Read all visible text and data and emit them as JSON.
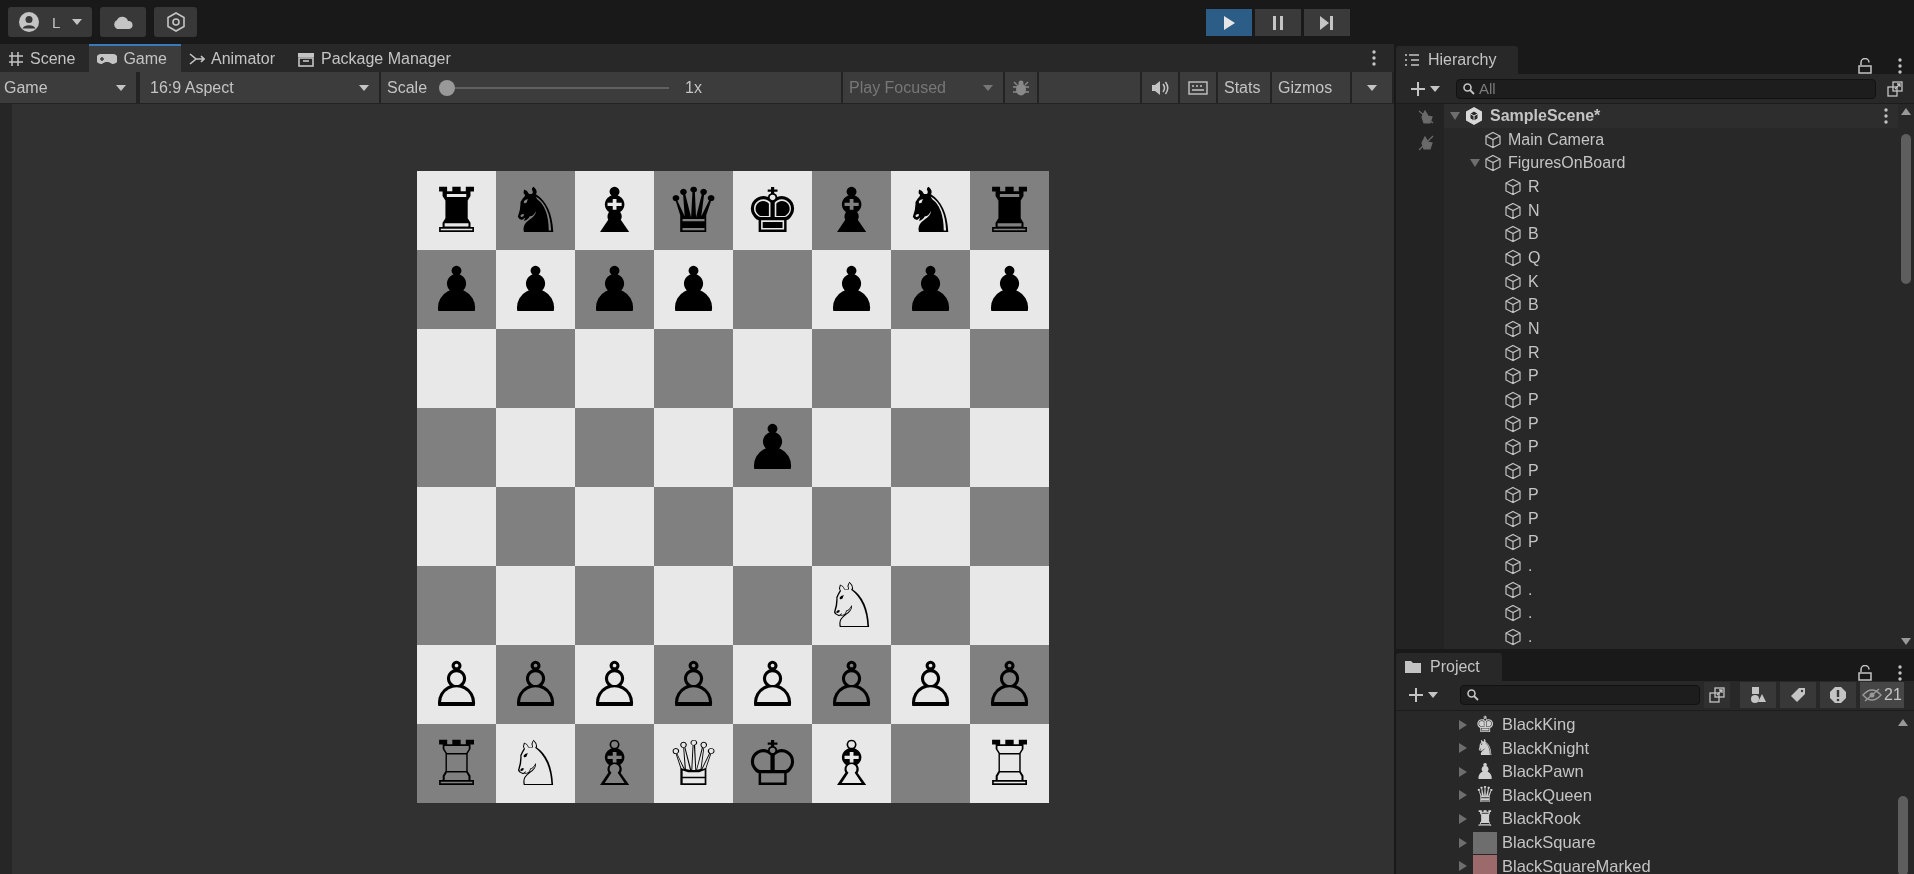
{
  "toolbar": {
    "account": {
      "label": "L"
    },
    "play_buttons": [
      {
        "kind": "play",
        "on": true
      },
      {
        "kind": "pause",
        "on": false
      },
      {
        "kind": "step",
        "on": false
      }
    ]
  },
  "editor_tabs": [
    {
      "label": "Scene",
      "kind": "scene",
      "selected": false
    },
    {
      "label": "Game",
      "kind": "game",
      "selected": true
    },
    {
      "label": "Animator",
      "kind": "animator",
      "selected": false
    },
    {
      "label": "Package Manager",
      "kind": "package",
      "selected": false
    }
  ],
  "game_toolbar": {
    "display": "Game",
    "aspect": "16:9 Aspect",
    "scale": {
      "label": "Scale",
      "level": 0,
      "reading": "1x"
    },
    "play_mode": "Play Focused",
    "stats": "Stats",
    "gizmos": "Gizmos"
  },
  "board": {
    "ranks": [
      [
        {
          "color": "#e8e8e8",
          "piece": "♜"
        },
        {
          "color": "#808080",
          "piece": "♞"
        },
        {
          "color": "#e8e8e8",
          "piece": "♝"
        },
        {
          "color": "#808080",
          "piece": "♛"
        },
        {
          "color": "#e8e8e8",
          "piece": "♚"
        },
        {
          "color": "#808080",
          "piece": "♝"
        },
        {
          "color": "#e8e8e8",
          "piece": "♞"
        },
        {
          "color": "#808080",
          "piece": "♜"
        }
      ],
      [
        {
          "color": "#808080",
          "piece": "♟"
        },
        {
          "color": "#e8e8e8",
          "piece": "♟"
        },
        {
          "color": "#808080",
          "piece": "♟"
        },
        {
          "color": "#e8e8e8",
          "piece": "♟"
        },
        {
          "color": "#808080"
        },
        {
          "color": "#e8e8e8",
          "piece": "♟"
        },
        {
          "color": "#808080",
          "piece": "♟"
        },
        {
          "color": "#e8e8e8",
          "piece": "♟"
        }
      ],
      [
        {
          "color": "#e8e8e8"
        },
        {
          "color": "#808080"
        },
        {
          "color": "#e8e8e8"
        },
        {
          "color": "#808080"
        },
        {
          "color": "#e8e8e8"
        },
        {
          "color": "#808080"
        },
        {
          "color": "#e8e8e8"
        },
        {
          "color": "#808080"
        }
      ],
      [
        {
          "color": "#808080"
        },
        {
          "color": "#e8e8e8"
        },
        {
          "color": "#808080"
        },
        {
          "color": "#e8e8e8"
        },
        {
          "color": "#808080",
          "piece": "♟"
        },
        {
          "color": "#e8e8e8"
        },
        {
          "color": "#808080"
        },
        {
          "color": "#e8e8e8"
        }
      ],
      [
        {
          "color": "#e8e8e8"
        },
        {
          "color": "#808080"
        },
        {
          "color": "#e8e8e8"
        },
        {
          "color": "#808080"
        },
        {
          "color": "#e8e8e8"
        },
        {
          "color": "#808080"
        },
        {
          "color": "#e8e8e8"
        },
        {
          "color": "#808080"
        }
      ],
      [
        {
          "color": "#808080"
        },
        {
          "color": "#e8e8e8"
        },
        {
          "color": "#808080"
        },
        {
          "color": "#e8e8e8"
        },
        {
          "color": "#808080"
        },
        {
          "color": "#e8e8e8",
          "piece": "♘"
        },
        {
          "color": "#808080"
        },
        {
          "color": "#e8e8e8"
        }
      ],
      [
        {
          "color": "#e8e8e8",
          "piece": "♙"
        },
        {
          "color": "#808080",
          "piece": "♙"
        },
        {
          "color": "#e8e8e8",
          "piece": "♙"
        },
        {
          "color": "#808080",
          "piece": "♙"
        },
        {
          "color": "#e8e8e8",
          "piece": "♙"
        },
        {
          "color": "#808080",
          "piece": "♙"
        },
        {
          "color": "#e8e8e8",
          "piece": "♙"
        },
        {
          "color": "#808080",
          "piece": "♙"
        }
      ],
      [
        {
          "color": "#808080",
          "piece": "♖"
        },
        {
          "color": "#e8e8e8",
          "piece": "♘"
        },
        {
          "color": "#808080",
          "piece": "♗"
        },
        {
          "color": "#e8e8e8",
          "piece": "♕"
        },
        {
          "color": "#808080",
          "piece": "♔"
        },
        {
          "color": "#e8e8e8",
          "piece": "♗"
        },
        {
          "color": "#808080"
        },
        {
          "color": "#e8e8e8",
          "piece": "♖"
        }
      ]
    ]
  },
  "hierarchy": {
    "title": "Hierarchy",
    "search": {
      "placeholder": "All"
    },
    "items": [
      {
        "label": "SampleScene*",
        "kind": "scene",
        "expanded": true,
        "children": [
          {
            "label": "Main Camera",
            "kind": "object"
          },
          {
            "label": "FiguresOnBoard",
            "kind": "object",
            "expanded": true,
            "children": [
              {
                "label": "R",
                "kind": "object"
              },
              {
                "label": "N",
                "kind": "object"
              },
              {
                "label": "B",
                "kind": "object"
              },
              {
                "label": "Q",
                "kind": "object"
              },
              {
                "label": "K",
                "kind": "object"
              },
              {
                "label": "B",
                "kind": "object"
              },
              {
                "label": "N",
                "kind": "object"
              },
              {
                "label": "R",
                "kind": "object"
              },
              {
                "label": "P",
                "kind": "object"
              },
              {
                "label": "P",
                "kind": "object"
              },
              {
                "label": "P",
                "kind": "object"
              },
              {
                "label": "P",
                "kind": "object"
              },
              {
                "label": "P",
                "kind": "object"
              },
              {
                "label": "P",
                "kind": "object"
              },
              {
                "label": "P",
                "kind": "object"
              },
              {
                "label": "P",
                "kind": "object"
              },
              {
                "label": ".",
                "kind": "object"
              },
              {
                "label": ".",
                "kind": "object"
              },
              {
                "label": ".",
                "kind": "object"
              },
              {
                "label": ".",
                "kind": "object"
              }
            ]
          }
        ]
      }
    ]
  },
  "project": {
    "title": "Project",
    "hidden_count": "21",
    "items": [
      {
        "name": "BlackKing",
        "kind": "sprite",
        "icon": "♚",
        "expanded": false
      },
      {
        "name": "BlackKnight",
        "kind": "sprite",
        "icon": "♞",
        "expanded": false
      },
      {
        "name": "BlackPawn",
        "kind": "sprite",
        "icon": "♟",
        "expanded": false
      },
      {
        "name": "BlackQueen",
        "kind": "sprite",
        "icon": "♛",
        "expanded": false
      },
      {
        "name": "BlackRook",
        "kind": "sprite",
        "icon": "♜",
        "expanded": false
      },
      {
        "name": "BlackSquare",
        "kind": "swatch",
        "color": "#6e6e6e",
        "expanded": false
      },
      {
        "name": "BlackSquareMarked",
        "kind": "swatch",
        "color": "#9c6a6a",
        "expanded": false
      }
    ]
  }
}
